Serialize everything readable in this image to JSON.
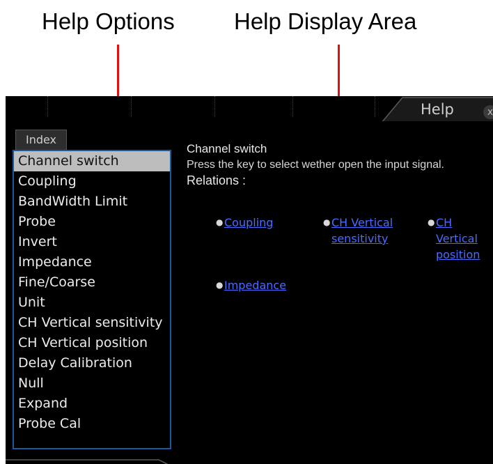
{
  "annotations": {
    "left_label": "Help Options",
    "right_label": "Help Display Area"
  },
  "window": {
    "title": "Help",
    "close_icon": "x"
  },
  "index": {
    "tab_label": "Index",
    "items": [
      "Channel switch",
      "Coupling",
      "BandWidth Limit",
      "Probe",
      "Invert",
      "Impedance",
      "Fine/Coarse",
      "Unit",
      "CH Vertical sensitivity",
      "CH Vertical position",
      "Delay Calibration",
      "Null",
      "Expand",
      "Probe Cal"
    ],
    "selected": "Channel switch"
  },
  "display": {
    "heading": "Channel switch",
    "description": "Press the key to select wether open the input signal.",
    "relations_label": "Relations :",
    "links": [
      "Coupling",
      "CH Vertical sensitivity",
      "CH Vertical position",
      "Impedance"
    ]
  },
  "colors": {
    "annotation_arrow": "#e01010",
    "panel_border": "#1c5aa0",
    "link": "#4a6bff",
    "selected_bg": "#bdbdbd"
  }
}
